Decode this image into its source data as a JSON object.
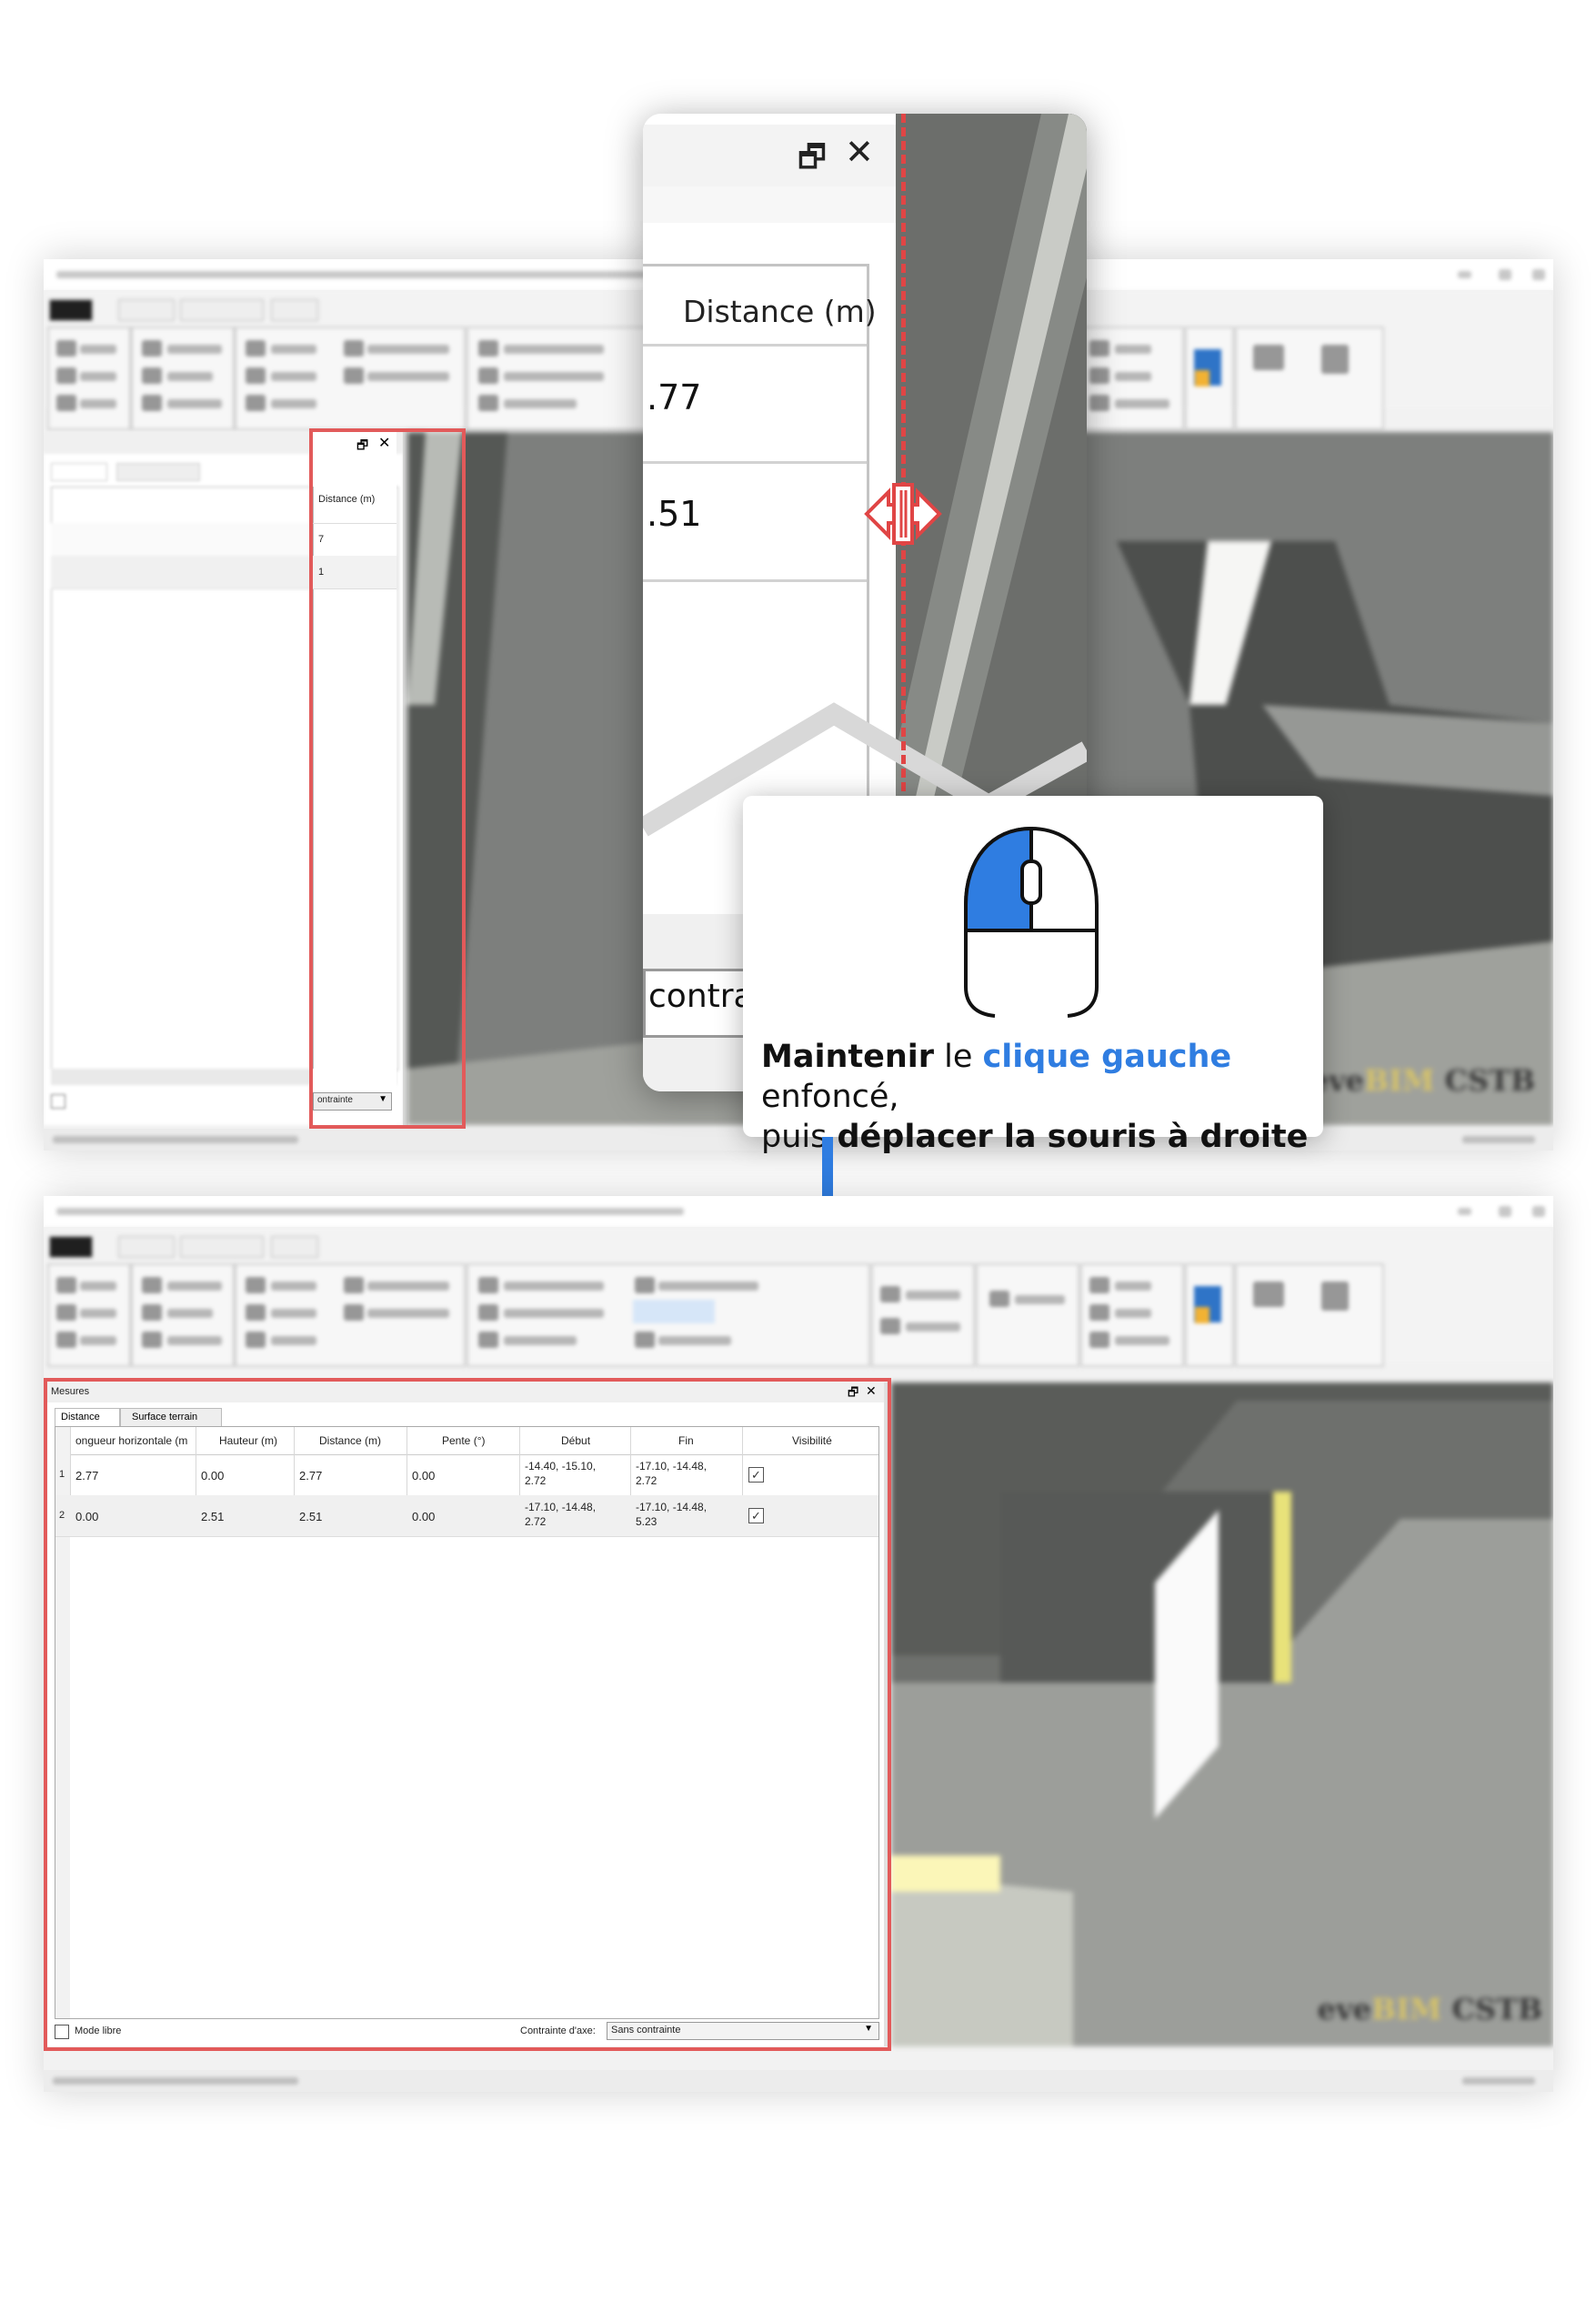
{
  "zoom": {
    "column_header": "Distance (m)",
    "row1_value": ".77",
    "row2_value": ".51",
    "footer_text": "contra"
  },
  "tooltip": {
    "bold_start": "Maintenir",
    "text_le": " le ",
    "highlight": "clique gauche",
    "text_end": " enfoncé,",
    "line2_start": "puis ",
    "line2_bold": "déplacer la souris à droite"
  },
  "window1": {
    "panel_header": "Distance (m)",
    "row1": "7",
    "row2": "1",
    "constraint_combo": "ontrainte"
  },
  "window2": {
    "panel_title": "Mesures",
    "tabs": [
      "Distance",
      "Surface terrain"
    ],
    "columns": [
      "ongueur horizontale (m",
      "Hauteur (m)",
      "Distance (m)",
      "Pente (°)",
      "Début",
      "Fin",
      "Visibilité"
    ],
    "rows": [
      {
        "idx": "1",
        "horiz": "2.77",
        "hauteur": "0.00",
        "distance": "2.77",
        "pente": "0.00",
        "debut_1": "-14.40, -15.10,",
        "debut_2": "2.72",
        "fin_1": "-17.10, -14.48,",
        "fin_2": "2.72",
        "visible": "✓"
      },
      {
        "idx": "2",
        "horiz": "0.00",
        "hauteur": "2.51",
        "distance": "2.51",
        "pente": "0.00",
        "debut_1": "-17.10, -14.48,",
        "debut_2": "2.72",
        "fin_1": "-17.10, -14.48,",
        "fin_2": "5.23",
        "visible": "✓"
      }
    ],
    "mode_libre": "Mode libre",
    "axis_constraint_label": "Contrainte d'axe:",
    "axis_constraint_value": "Sans contrainte"
  },
  "watermark": "CSTB",
  "colors": {
    "accent_red": "#e25a5a",
    "arrow_blue": "#2f7de1",
    "mouse_blue": "#2f7de1"
  }
}
